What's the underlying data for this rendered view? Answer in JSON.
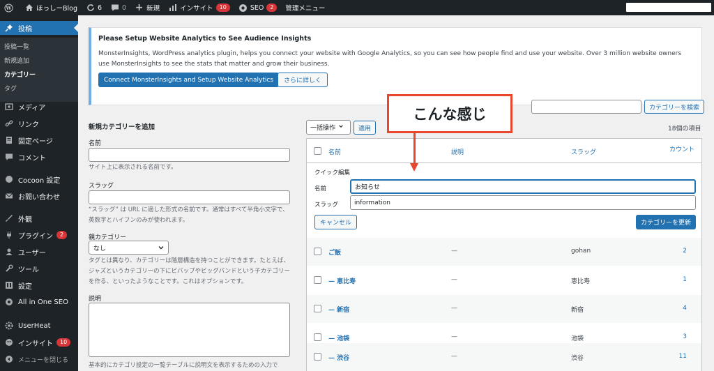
{
  "adminbar": {
    "site_name": "ほっしーBlog",
    "updates_count": "6",
    "comments_count": "0",
    "new_label": "新規",
    "insights_label": "インサイト",
    "insights_badge": "10",
    "seo_label": "SEO",
    "seo_badge": "2",
    "admin_menu_label": "管理メニュー"
  },
  "sidebar": {
    "posts": "投稿",
    "sub": [
      "投稿一覧",
      "新規追加",
      "カテゴリー",
      "タグ"
    ],
    "items": [
      "メディア",
      "リンク",
      "固定ページ",
      "コメント",
      "Cocoon 設定",
      "お問い合わせ",
      "外観",
      "プラグイン",
      "ユーザー",
      "ツール",
      "設定",
      "All in One SEO",
      "UserHeat",
      "インサイト",
      "メニューを閉じる"
    ],
    "plugins_badge": "2",
    "insights_badge": "10"
  },
  "notice": {
    "title": "Please Setup Website Analytics to See Audience Insights",
    "body": "MonsterInsights, WordPress analytics plugin, helps you connect your website with Google Analytics, so you can see how people find and use your website. Over 3 million website owners use MonsterInsights to see the stats that matter and grow their business.",
    "primary_button": "Connect MonsterInsights and Setup Website Analytics",
    "secondary_button": "さらに詳しく"
  },
  "search": {
    "button": "カテゴリーを検索",
    "value": ""
  },
  "annotation": {
    "text": "こんな感じ",
    "color": "#e8472d"
  },
  "form": {
    "heading": "新規カテゴリーを追加",
    "name_label": "名前",
    "name_help": "サイト上に表示される名前です。",
    "slug_label": "スラッグ",
    "slug_help": "“スラッグ” は URL に適した形式の名前です。通常はすべて半角小文字で、英数字とハイフンのみが使われます。",
    "parent_label": "親カテゴリー",
    "parent_value": "なし",
    "parent_help": "タグとは異なり、カテゴリーは階層構造を持つことができます。たとえば、ジャズというカテゴリーの下にビバップやビッグバンドという子カテゴリーを作る、といったようなことです。これはオプションです。",
    "desc_label": "説明",
    "desc_help": "基本的にカテゴリ設定の一覧テーブルに説明文を表示するための入力で"
  },
  "bulk": {
    "select": "一括操作",
    "apply": "適用",
    "count": "18個の項目"
  },
  "table": {
    "headers": {
      "name": "名前",
      "desc": "説明",
      "slug": "スラッグ",
      "count": "カウント"
    },
    "quick_edit": {
      "title": "クイック編集",
      "name_label": "名前",
      "name_value": "お知らせ",
      "slug_label": "スラッグ",
      "slug_value": "information",
      "cancel": "キャンセル",
      "update": "カテゴリーを更新"
    },
    "rows": [
      {
        "name": "ご飯",
        "desc": "—",
        "slug": "gohan",
        "count": "2"
      },
      {
        "name": "— 恵比寿",
        "desc": "—",
        "slug": "恵比寿",
        "count": "1"
      },
      {
        "name": "— 新宿",
        "desc": "—",
        "slug": "新宿",
        "count": "4"
      },
      {
        "name": "— 池袋",
        "desc": "—",
        "slug": "池袋",
        "count": "3"
      },
      {
        "name": "— 渋谷",
        "desc": "—",
        "slug": "渋谷",
        "count": "11"
      }
    ]
  },
  "colors": {
    "primary": "#2271b1",
    "sidebar": "#1d2327",
    "badge": "#d63638"
  }
}
